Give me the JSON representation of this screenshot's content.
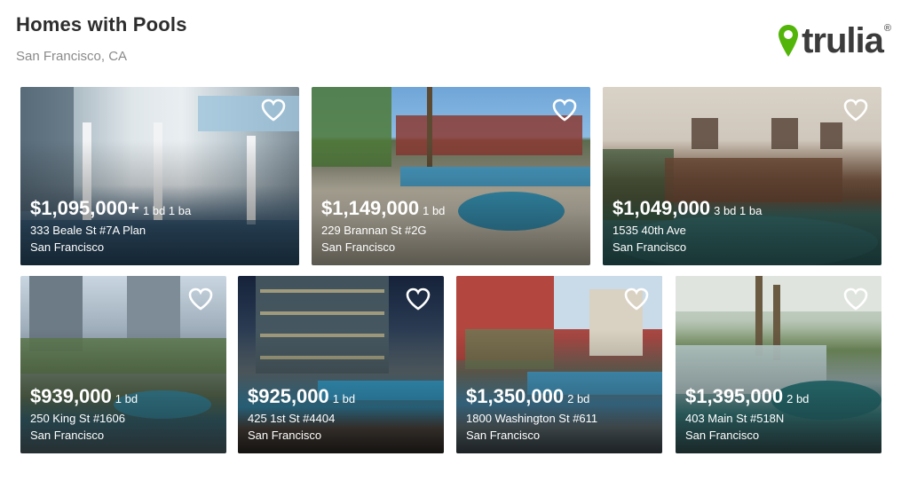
{
  "header": {
    "title": "Homes with Pools",
    "subtitle": "San Francisco, CA"
  },
  "brand": {
    "name": "trulia",
    "registered": "®",
    "pin_color": "#53b50a",
    "text_color": "#3b3b3b"
  },
  "listings": [
    {
      "price": "$1,095,000+",
      "beds": "1 bd 1 ba",
      "address": "333 Beale St #7A Plan",
      "city": "San Francisco"
    },
    {
      "price": "$1,149,000",
      "beds": "1 bd",
      "address": "229 Brannan St #2G",
      "city": "San Francisco"
    },
    {
      "price": "$1,049,000",
      "beds": "3 bd 1 ba",
      "address": "1535 40th Ave",
      "city": "San Francisco"
    },
    {
      "price": "$939,000",
      "beds": "1 bd",
      "address": "250 King St #1606",
      "city": "San Francisco"
    },
    {
      "price": "$925,000",
      "beds": "1 bd",
      "address": "425 1st St #4404",
      "city": "San Francisco"
    },
    {
      "price": "$1,350,000",
      "beds": "2 bd",
      "address": "1800 Washington St #611",
      "city": "San Francisco"
    },
    {
      "price": "$1,395,000",
      "beds": "2 bd",
      "address": "403 Main St #518N",
      "city": "San Francisco"
    }
  ],
  "icons": {
    "favorite": "heart-icon",
    "logo_pin": "map-pin-icon"
  }
}
